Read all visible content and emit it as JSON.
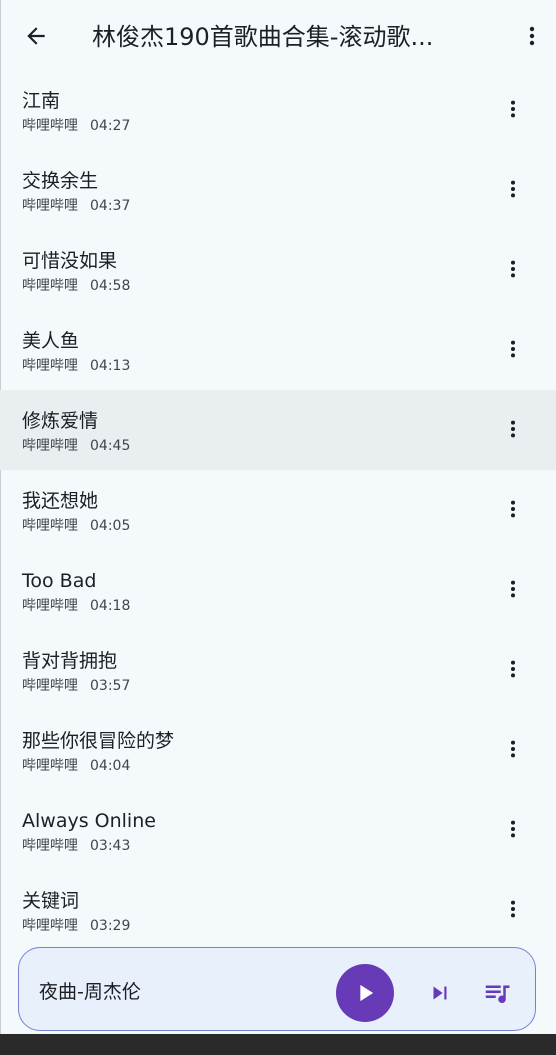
{
  "appbar": {
    "title": "林俊杰190首歌曲合集-滚动歌...",
    "back_icon": "arrow-left-icon",
    "more_icon": "more-vert-icon"
  },
  "songs": [
    {
      "title": "江南",
      "artist": "哔哩哔哩",
      "duration": "04:27"
    },
    {
      "title": "交换余生",
      "artist": "哔哩哔哩",
      "duration": "04:37"
    },
    {
      "title": "可惜没如果",
      "artist": "哔哩哔哩",
      "duration": "04:58"
    },
    {
      "title": "美人鱼",
      "artist": "哔哩哔哩",
      "duration": "04:13"
    },
    {
      "title": "修炼爱情",
      "artist": "哔哩哔哩",
      "duration": "04:45",
      "active": true
    },
    {
      "title": "我还想她",
      "artist": "哔哩哔哩",
      "duration": "04:05"
    },
    {
      "title": "Too Bad",
      "artist": "哔哩哔哩",
      "duration": "04:18"
    },
    {
      "title": "背对背拥抱",
      "artist": "哔哩哔哩",
      "duration": "03:57"
    },
    {
      "title": "那些你很冒险的梦",
      "artist": "哔哩哔哩",
      "duration": "04:04"
    },
    {
      "title": "Always Online",
      "artist": "哔哩哔哩",
      "duration": "03:43"
    },
    {
      "title": "关键词",
      "artist": "哔哩哔哩",
      "duration": "03:29"
    }
  ],
  "player": {
    "now_playing": "夜曲-周杰伦",
    "play_icon": "play-icon",
    "next_icon": "skip-next-icon",
    "queue_icon": "queue-music-icon"
  },
  "colors": {
    "background": "#f4f9fb",
    "active_row": "#e9eef0",
    "accent": "#673ab7",
    "player_bg": "#e7f0fb",
    "player_border": "#7a7fd6",
    "system_bar": "#2a2a2b"
  }
}
